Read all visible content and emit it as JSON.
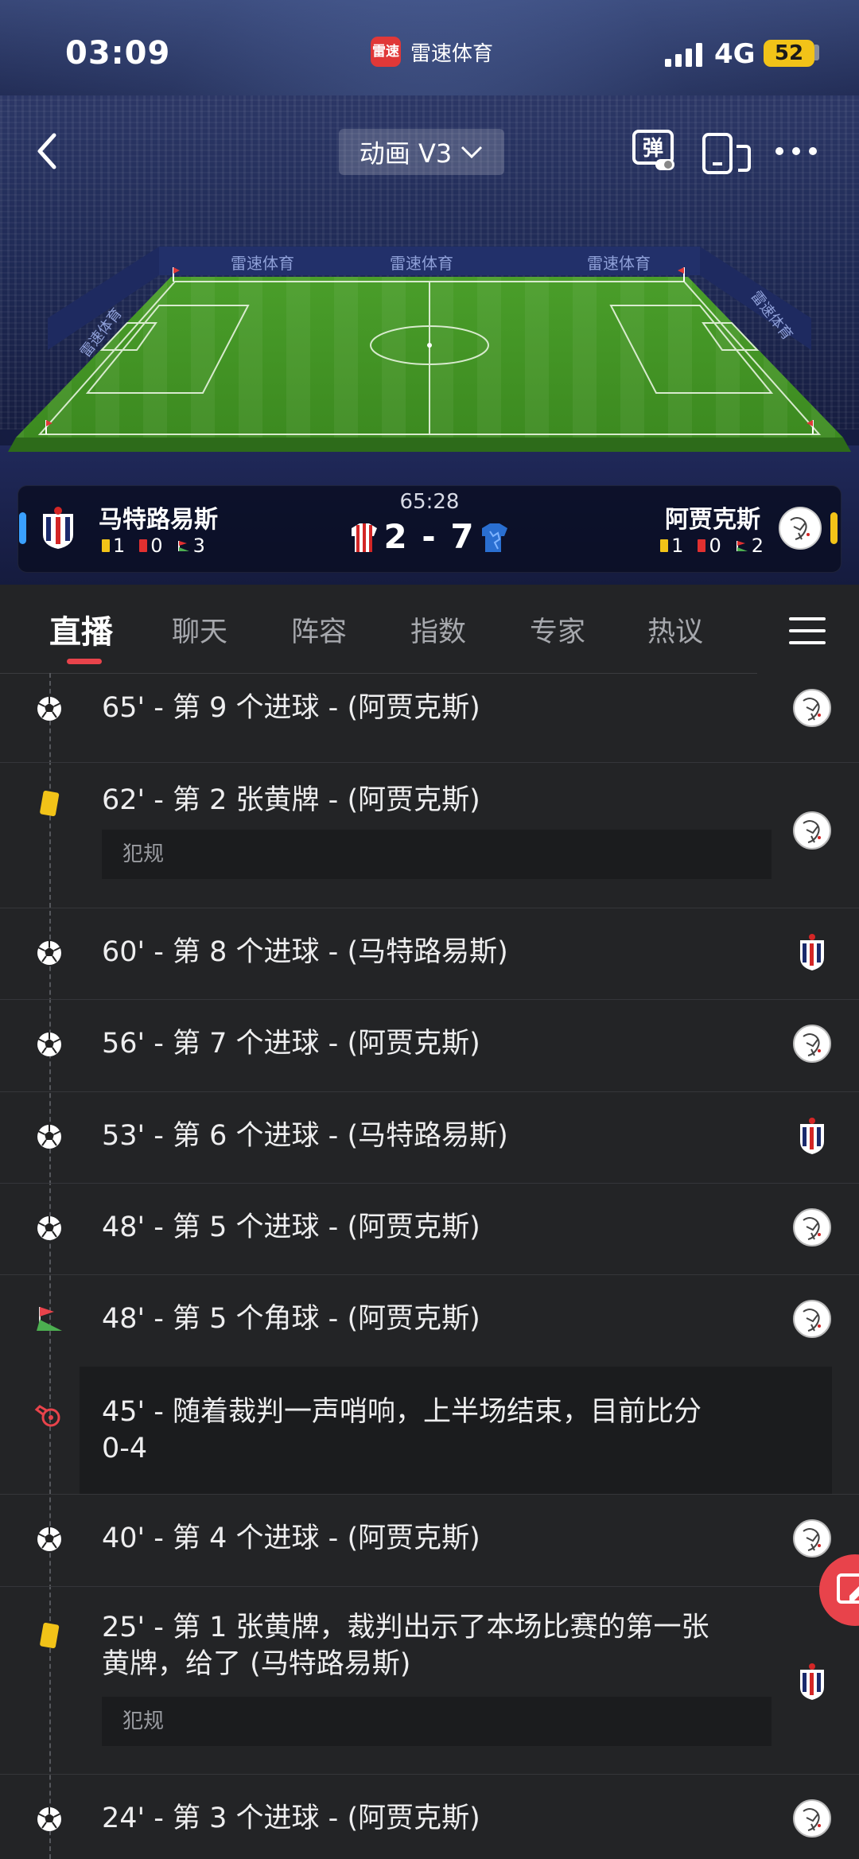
{
  "status_bar": {
    "time": "03:09",
    "app_name": "雷速体育",
    "app_logo_text": "雷速",
    "network": "4G",
    "battery": "52"
  },
  "nav": {
    "animation_select": "动画 V3",
    "danmu_label": "弹"
  },
  "pitch_ads": [
    "雷速体育",
    "雷速体育",
    "雷速体育",
    "雷速体育",
    "雷速体育"
  ],
  "match": {
    "time": "65:28",
    "score": "2 - 7",
    "home": {
      "name": "马特路易斯",
      "yellow": "1",
      "red": "0",
      "corners": "3",
      "indicator_color": "#3aa0ff"
    },
    "away": {
      "name": "阿贾克斯",
      "yellow": "1",
      "red": "0",
      "corners": "2",
      "indicator_color": "#f2c318"
    }
  },
  "tabs": [
    {
      "label": "直播",
      "active": true
    },
    {
      "label": "聊天",
      "active": false
    },
    {
      "label": "阵容",
      "active": false
    },
    {
      "label": "指数",
      "active": false
    },
    {
      "label": "专家",
      "active": false
    },
    {
      "label": "热议",
      "active": false
    }
  ],
  "colors": {
    "accent": "#e8434b",
    "background": "#232426",
    "note_bg": "#1b1c1e"
  },
  "events": [
    {
      "icon": "football-icon",
      "text": "65' - 第 9 个进球 - (阿贾克斯)",
      "team": "away"
    },
    {
      "icon": "yellow-card-icon",
      "text": "62' - 第 2 张黄牌 - (阿贾克斯)",
      "team": "away",
      "note": "犯规"
    },
    {
      "icon": "football-icon",
      "text": "60' - 第 8 个进球 - (马特路易斯)",
      "team": "home"
    },
    {
      "icon": "football-icon",
      "text": "56' - 第 7 个进球 - (阿贾克斯)",
      "team": "away"
    },
    {
      "icon": "football-icon",
      "text": "53' - 第 6 个进球 - (马特路易斯)",
      "team": "home"
    },
    {
      "icon": "football-icon",
      "text": "48' - 第 5 个进球 - (阿贾克斯)",
      "team": "away"
    },
    {
      "icon": "corner-flag-icon",
      "text": "48' - 第 5 个角球 - (阿贾克斯)",
      "team": "away"
    },
    {
      "icon": "whistle-icon",
      "text_line1": "45' - 随着裁判一声哨响，上半场结束，目前比分",
      "text_line2": "0-4",
      "team": ""
    },
    {
      "icon": "football-icon",
      "text": "40' - 第 4 个进球 - (阿贾克斯)",
      "team": "away"
    },
    {
      "icon": "yellow-card-icon",
      "text_line1": "25' - 第 1 张黄牌，裁判出示了本场比赛的第一张",
      "text_line2": "黄牌，给了 (马特路易斯)",
      "team": "home",
      "note": "犯规"
    },
    {
      "icon": "football-icon",
      "text": "24' - 第 3 个进球 - (阿贾克斯)",
      "team": "away"
    }
  ]
}
